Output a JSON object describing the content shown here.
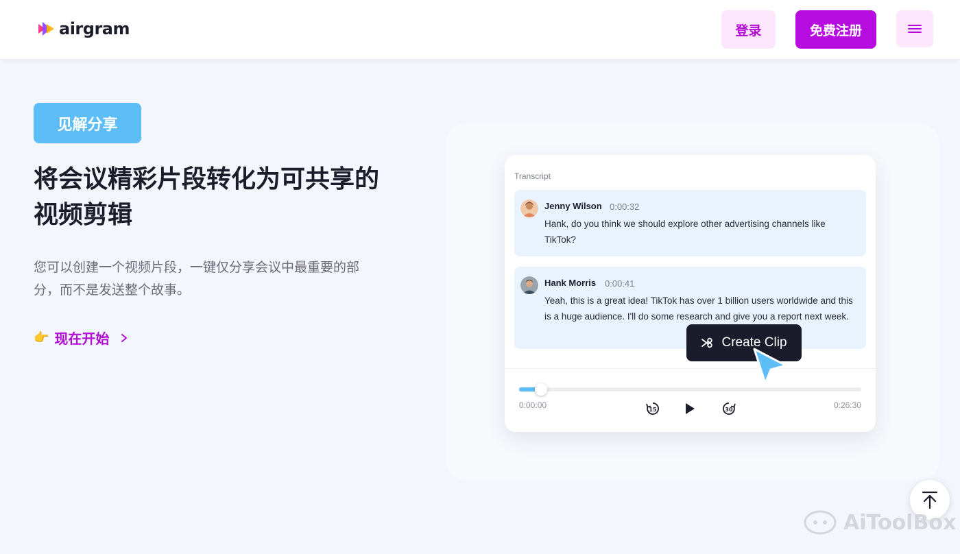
{
  "header": {
    "logo_text": "airgram",
    "login_label": "登录",
    "signup_label": "免费注册"
  },
  "hero": {
    "badge": "见解分享",
    "headline": "将会议精彩片段转化为可共享的视频剪辑",
    "description": "您可以创建一个视频片段，一键仅分享会议中最重要的部分，而不是发送整个故事。",
    "cta_emoji": "👉",
    "cta_label": "现在开始"
  },
  "transcript_card": {
    "label": "Transcript",
    "messages": [
      {
        "name": "Jenny Wilson",
        "time": "0:00:32",
        "text": "Hank, do you think we should explore other advertising channels like TikTok?"
      },
      {
        "name": "Hank Morris",
        "time": "0:00:41",
        "text": "Yeah, this is a great idea! TikTok has over 1 billion users worldwide and this is a huge audience. I'll do some research and give you a report next week."
      }
    ],
    "create_clip_label": "Create Clip",
    "player": {
      "time_start": "0:00:00",
      "time_end": "0:26:30",
      "progress_fraction": 0.065,
      "skip_back_label": "15",
      "skip_forward_label": "30"
    }
  },
  "watermark": "AiToolBox",
  "colors": {
    "brand_purple": "#b60ce0",
    "accent_blue": "#5cbdf7",
    "dark": "#1a1c2b"
  }
}
